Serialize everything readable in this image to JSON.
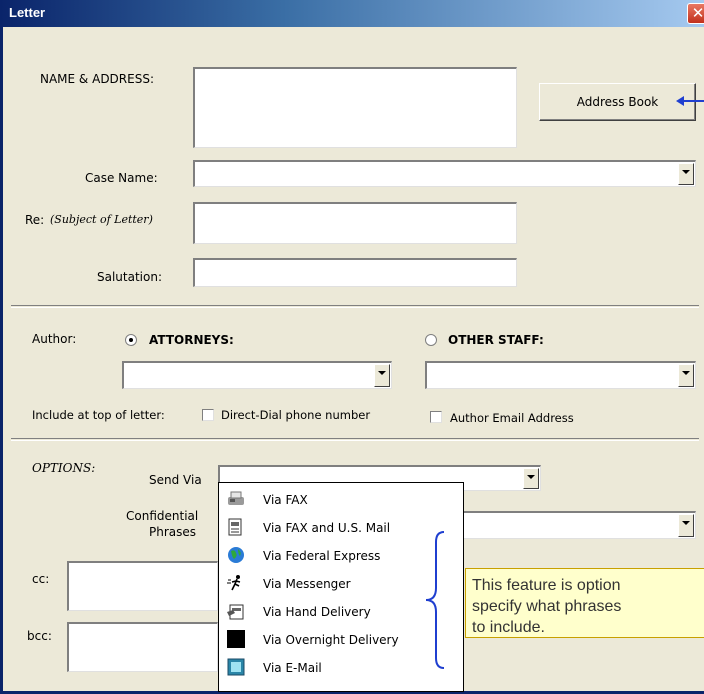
{
  "window": {
    "title": "Letter",
    "close_glyph": "✕"
  },
  "form": {
    "name_address_label": "NAME & ADDRESS:",
    "address_book_label": "Address Book",
    "case_name_label": "Case Name:",
    "re_label": "Re:",
    "re_hint": "(Subject of Letter)",
    "salutation_label": "Salutation:",
    "author_label": "Author:",
    "attorneys_label": "ATTORNEYS:",
    "other_staff_label": "OTHER STAFF:",
    "include_label": "Include at top of letter:",
    "direct_dial_label": "Direct-Dial phone number",
    "author_email_label": "Author Email Address",
    "options_label": "OPTIONS:",
    "send_via_label": "Send Via",
    "confidential_label_1": "Confidential",
    "confidential_label_2": "Phrases",
    "cc_label": "cc:",
    "bcc_label": "bcc:"
  },
  "send_via_options": [
    {
      "label": "Via FAX",
      "icon": "fax-icon"
    },
    {
      "label": "Via FAX and U.S. Mail",
      "icon": "fax-mail-icon"
    },
    {
      "label": "Via Federal Express",
      "icon": "globe-icon"
    },
    {
      "label": "Via Messenger",
      "icon": "runner-icon"
    },
    {
      "label": "Via Hand Delivery",
      "icon": "hand-delivery-icon"
    },
    {
      "label": "Via Overnight Delivery",
      "icon": "moon-icon"
    },
    {
      "label": "Via E-Mail",
      "icon": "email-icon"
    }
  ],
  "callout": {
    "line1": "This feature is option",
    "line2": "specify what phrases",
    "line3": "to include."
  },
  "colors": {
    "titlebar": "#0A246A",
    "arrow": "#1F3FD0",
    "brace": "#1F3FD0",
    "callout_bg": "#FFFFCC"
  }
}
